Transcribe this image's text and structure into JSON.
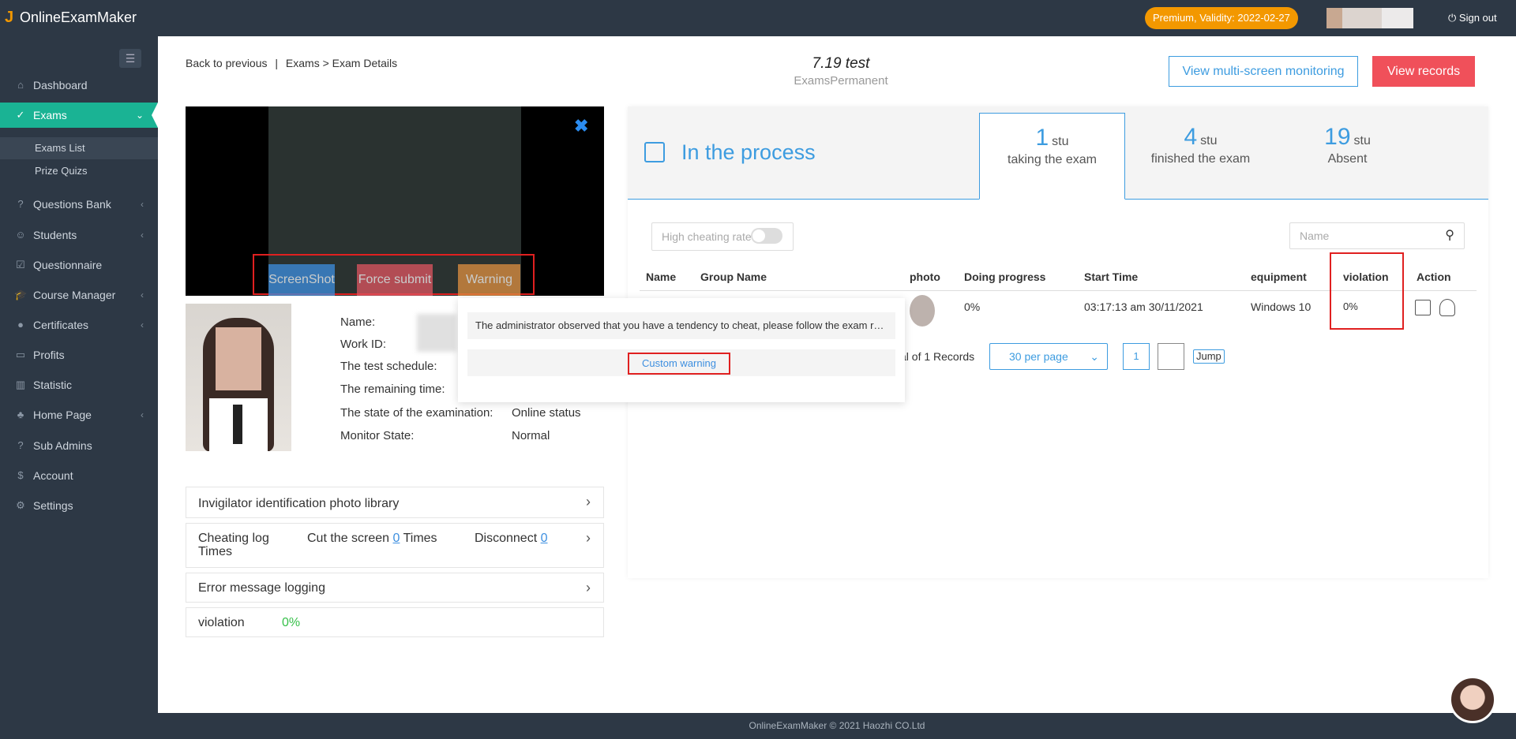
{
  "topbar": {
    "logo_text": "OnlineExamMaker",
    "premium": "Premium, Validity: 2022-02-27",
    "signout": "Sign out"
  },
  "sidebar": {
    "items": [
      {
        "label": "Dashboard",
        "icon": "home-icon"
      },
      {
        "label": "Exams",
        "icon": "check-circle-icon",
        "active": true
      },
      {
        "label": "Questions Bank",
        "icon": "question-icon"
      },
      {
        "label": "Students",
        "icon": "users-icon"
      },
      {
        "label": "Questionnaire",
        "icon": "checkbox-icon"
      },
      {
        "label": "Course Manager",
        "icon": "graduation-icon"
      },
      {
        "label": "Certificates",
        "icon": "certificate-icon"
      },
      {
        "label": "Profits",
        "icon": "card-icon"
      },
      {
        "label": "Statistic",
        "icon": "bar-chart-icon"
      },
      {
        "label": "Home Page",
        "icon": "home-page-icon"
      },
      {
        "label": "Sub Admins",
        "icon": "question-icon"
      },
      {
        "label": "Account",
        "icon": "dollar-icon"
      },
      {
        "label": "Settings",
        "icon": "gear-icon"
      }
    ],
    "sub_items": [
      "Exams List",
      "Prize Quizs"
    ]
  },
  "breadcrumb": {
    "back": "Back to previous",
    "sep": "|",
    "path": "Exams > Exam Details"
  },
  "exam": {
    "title": "7.19 test",
    "subtitle": "ExamsPermanent"
  },
  "buttons": {
    "multi": "View multi-screen monitoring",
    "records": "View records"
  },
  "video": {
    "screenshot": "ScreenShot",
    "force_submit": "Force submit",
    "warning": "Warning"
  },
  "student_info": {
    "labels": [
      "Name:",
      "Work ID:",
      "The test schedule:",
      "The remaining time:",
      "The state of the examination:",
      "Monitor State:"
    ],
    "state": "Online status",
    "monitor": "Normal"
  },
  "popup": {
    "message": "The administrator observed that you have a tendency to cheat, please follow the exam rules",
    "custom_warning": "Custom warning"
  },
  "accordion": {
    "photo_library": "Invigilator identification photo library",
    "cheating_log": "Cheating log",
    "times": "Times",
    "cut_screen": "Cut the screen",
    "cut_count": "0",
    "times2": "Times",
    "disconnect": "Disconnect",
    "disconnect_count": "0",
    "error_log": "Error message logging",
    "violation": "violation",
    "violation_value": "0%"
  },
  "process": {
    "label": "In the process"
  },
  "stats": [
    {
      "num": "1",
      "unit": "stu",
      "label": "taking the exam"
    },
    {
      "num": "4",
      "unit": "stu",
      "label": "finished the exam"
    },
    {
      "num": "19",
      "unit": "stu",
      "label": "Absent"
    }
  ],
  "filter": {
    "high_cheating": "High cheating rate",
    "search_placeholder": "Name"
  },
  "table": {
    "headers": [
      "Name",
      "Group Name",
      "photo",
      "Doing progress",
      "Start Time",
      "equipment",
      "violation",
      "Action"
    ],
    "row": {
      "progress": "0%",
      "start_time": "03:17:13 am 30/11/2021",
      "equipment": "Windows 10",
      "violation": "0%"
    }
  },
  "pager": {
    "records": "al of 1 Records",
    "per_page": "30 per page",
    "page": "1",
    "jump": "Jump"
  },
  "footer": "OnlineExamMaker © 2021 Haozhi CO.Ltd"
}
